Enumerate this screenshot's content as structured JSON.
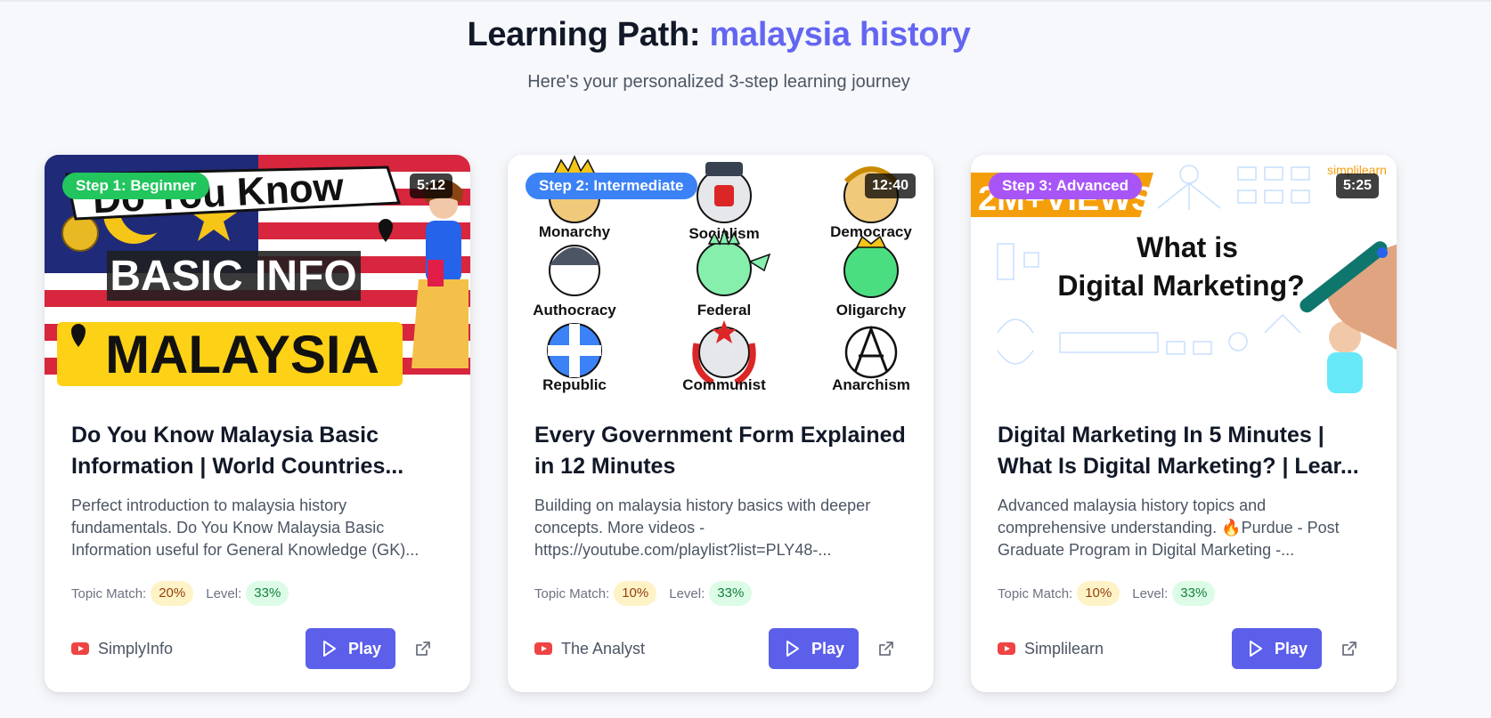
{
  "header": {
    "title_prefix": "Learning Path:",
    "topic": "malaysia history",
    "subtitle": "Here's your personalized 3-step learning journey"
  },
  "labels": {
    "topic_match": "Topic Match:",
    "level": "Level:",
    "play": "Play"
  },
  "colors": {
    "accent": "#6366f1",
    "step1": "#22c55e",
    "step2": "#3b82f6",
    "step3": "#a855f7"
  },
  "cards": [
    {
      "step": "Step 1: Beginner",
      "duration": "5:12",
      "title": "Do You Know Malaysia Basic Information | World Countries...",
      "description": "Perfect introduction to malaysia history fundamentals. Do You Know Malaysia Basic Information useful for General Knowledge (GK)...",
      "topic_match": "20%",
      "level": "33%",
      "channel": "SimplyInfo",
      "thumbnail": {
        "line1": "Do You Know",
        "line2": "BASIC INFO",
        "line3": "MALAYSIA"
      }
    },
    {
      "step": "Step 2: Intermediate",
      "duration": "12:40",
      "title": "Every Government Form Explained in 12 Minutes",
      "description": "Building on malaysia history basics with deeper concepts. More videos - https://youtube.com/playlist?list=PLY48-...",
      "topic_match": "10%",
      "level": "33%",
      "channel": "The Analyst",
      "thumbnail": {
        "labels": [
          "Monarchy",
          "Socialism",
          "Democracy",
          "Authocracy",
          "Federal",
          "Oligarchy",
          "Republic",
          "Communist",
          "Anarchism"
        ]
      }
    },
    {
      "step": "Step 3: Advanced",
      "duration": "5:25",
      "title": "Digital Marketing In 5 Minutes | What Is Digital Marketing? | Lear...",
      "description": "Advanced malaysia history topics and comprehensive understanding. 🔥Purdue - Post Graduate Program in Digital Marketing -...",
      "topic_match": "10%",
      "level": "33%",
      "channel": "Simplilearn",
      "thumbnail": {
        "banner": "2M+VIEWS",
        "line1": "What is",
        "line2": "Digital Marketing?",
        "brand": "simplilearn"
      }
    }
  ]
}
